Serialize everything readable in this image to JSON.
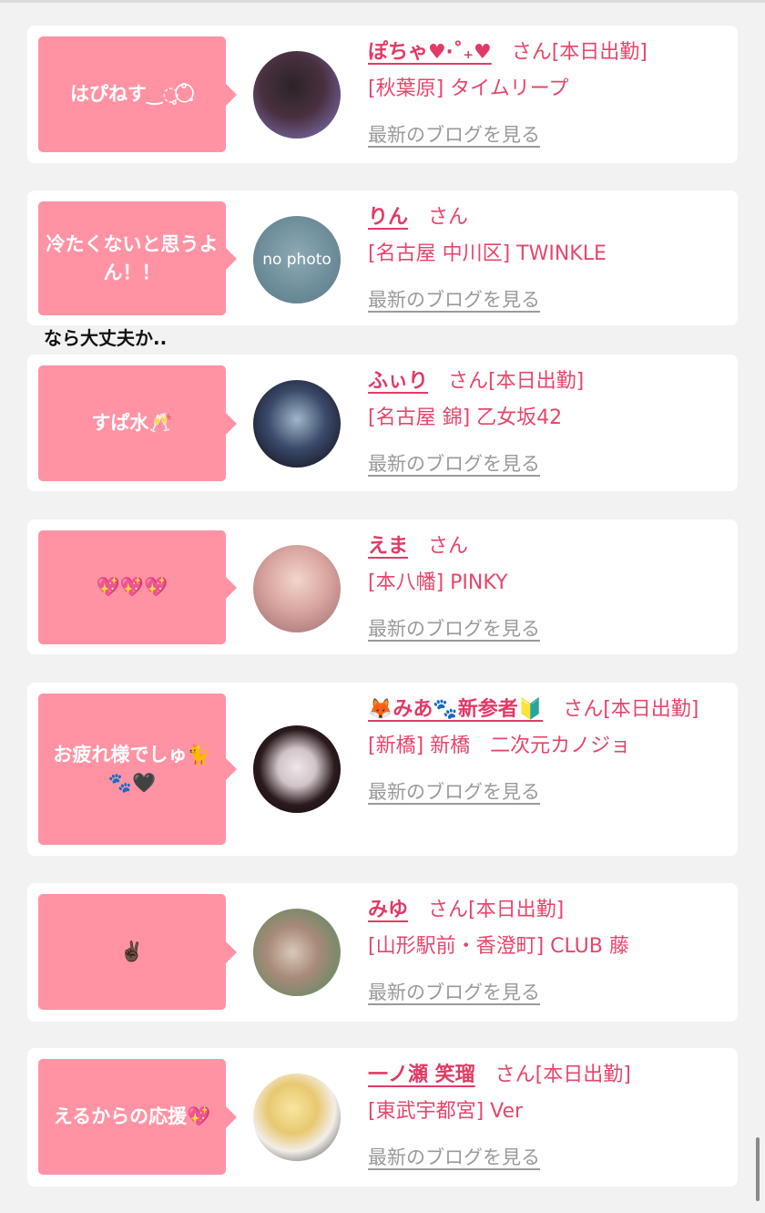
{
  "blog_link_label": "最新のブログを見る",
  "overflow_text": "なら大丈夫か..",
  "entries": [
    {
      "bubble": "はぴねす‿◌̥˚.⃝",
      "name": "ぽちゃ♥︎‧˚₊♥︎",
      "suffix": "さん[本日出勤]",
      "shop": "[秋葉原] タイムリープ",
      "avatar_icon": "avatar-photo"
    },
    {
      "bubble": "冷たくないと思うよん！！",
      "name": "りん",
      "suffix": "さん",
      "shop": "[名古屋 中川区] TWINKLE",
      "avatar_icon": "no-photo-placeholder",
      "avatar_text": "no photo"
    },
    {
      "bubble": "すぱ水🥂",
      "name": "ふぃり",
      "suffix": "さん[本日出勤]",
      "shop": "[名古屋 錦] 乙女坂42",
      "avatar_icon": "avatar-photo"
    },
    {
      "bubble": "💖💖💖",
      "name": "えま",
      "suffix": "さん",
      "shop": "[本八幡] PINKY",
      "avatar_icon": "avatar-photo"
    },
    {
      "bubble": "お疲れ様でしゅ🐈 🐾🖤",
      "name": "🦊みあ🐾新参者🔰",
      "suffix": "さん[本日出勤]",
      "shop": "[新橋] 新橋　二次元カノジョ",
      "avatar_icon": "avatar-photo"
    },
    {
      "bubble": "✌🏿",
      "name": "みゆ",
      "suffix": "さん[本日出勤]",
      "shop": "[山形駅前・香澄町] CLUB 藤",
      "avatar_icon": "avatar-photo"
    },
    {
      "bubble": "えるからの応援💖",
      "name": "一ノ瀬 笑瑠",
      "suffix": "さん[本日出勤]",
      "shop": "[東武宇都宮] Ver",
      "avatar_icon": "avatar-photo"
    }
  ]
}
